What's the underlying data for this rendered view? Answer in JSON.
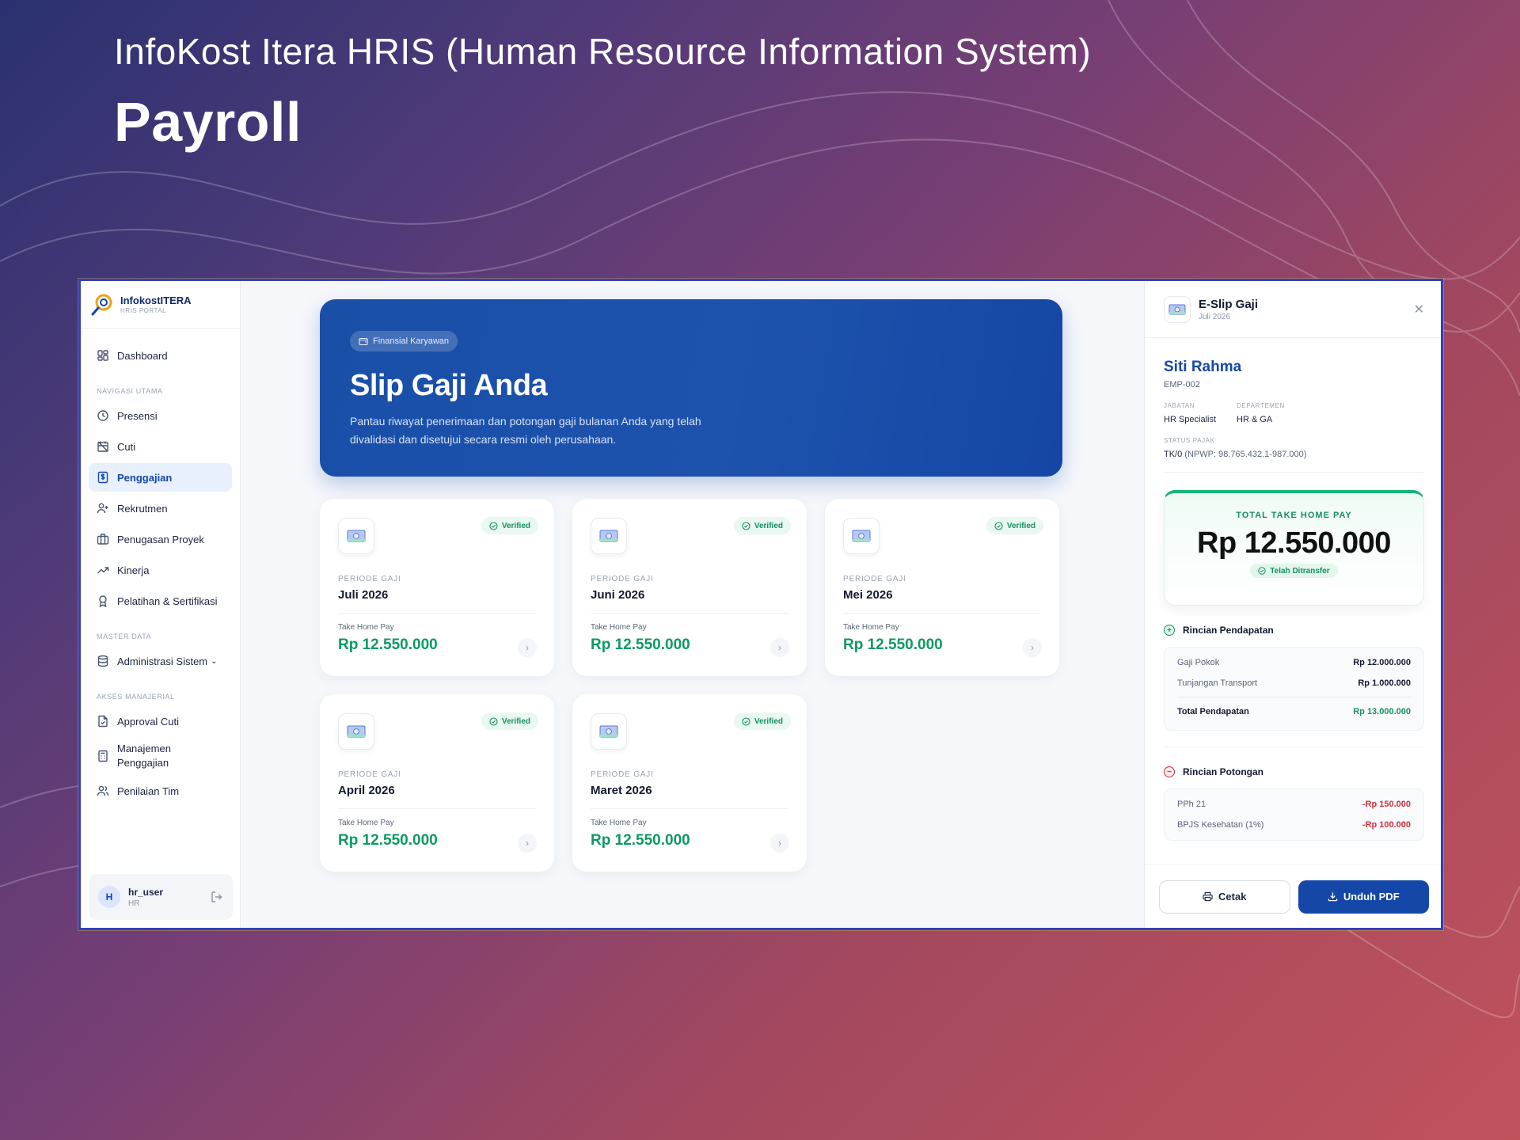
{
  "hero": {
    "subtitle": "InfoKost Itera HRIS (Human Resource Information System)",
    "title": "Payroll"
  },
  "brand": {
    "name": "InfokostITERA",
    "sub": "HRIS PORTAL"
  },
  "sidebar": {
    "dashboard": "Dashboard",
    "section_main": "NAVIGASI UTAMA",
    "items": [
      "Presensi",
      "Cuti",
      "Penggajian",
      "Rekrutmen",
      "Penugasan Proyek",
      "Kinerja",
      "Pelatihan & Sertifikasi"
    ],
    "section_master": "MASTER DATA",
    "master_item": "Administrasi Sistem",
    "section_manager": "AKSES MANAJERIAL",
    "manager_items": [
      "Approval Cuti",
      "Manajemen Penggajian",
      "Penilaian Tim"
    ],
    "user": {
      "initial": "H",
      "name": "hr_user",
      "role": "HR"
    }
  },
  "banner": {
    "pill": "Finansial Karyawan",
    "title": "Slip Gaji Anda",
    "description": "Pantau riwayat penerimaan dan potongan gaji bulanan Anda yang telah divalidasi dan disetujui secara resmi oleh perusahaan."
  },
  "cards": {
    "badge": "Verified",
    "period_label": "PERIODE GAJI",
    "thp_label": "Take Home Pay",
    "items": [
      {
        "period": "Juli 2026",
        "amount": "Rp 12.550.000"
      },
      {
        "period": "Juni 2026",
        "amount": "Rp 12.550.000"
      },
      {
        "period": "Mei 2026",
        "amount": "Rp 12.550.000"
      },
      {
        "period": "April 2026",
        "amount": "Rp 12.550.000"
      },
      {
        "period": "Maret 2026",
        "amount": "Rp 12.550.000"
      }
    ]
  },
  "panel": {
    "title": "E-Slip Gaji",
    "subtitle": "Juli 2026",
    "employee": {
      "name": "Siti Rahma",
      "id": "EMP-002",
      "jabatan_label": "JABATAN",
      "jabatan": "HR Specialist",
      "departemen_label": "DEPARTEMEN",
      "departemen": "HR & GA",
      "pajak_label": "STATUS PAJAK",
      "pajak": "TK/0",
      "npwp": "(NPWP: 98.765.432.1-987.000)"
    },
    "total_label": "TOTAL TAKE HOME PAY",
    "total_value": "Rp 12.550.000",
    "transfer_status": "Telah Ditransfer",
    "income_title": "Rincian Pendapatan",
    "income": [
      {
        "label": "Gaji Pokok",
        "amount": "Rp 12.000.000"
      },
      {
        "label": "Tunjangan Transport",
        "amount": "Rp 1.000.000"
      }
    ],
    "income_total_label": "Total Pendapatan",
    "income_total": "Rp 13.000.000",
    "deduction_title": "Rincian Potongan",
    "deductions": [
      {
        "label": "PPh 21",
        "amount": "-Rp 150.000"
      },
      {
        "label": "BPJS Kesehatan (1%)",
        "amount": "-Rp 100.000"
      }
    ],
    "print_label": "Cetak",
    "download_label": "Unduh PDF"
  },
  "colors": {
    "primary": "#1547a8",
    "success": "#0c9a62",
    "danger": "#d03040"
  }
}
